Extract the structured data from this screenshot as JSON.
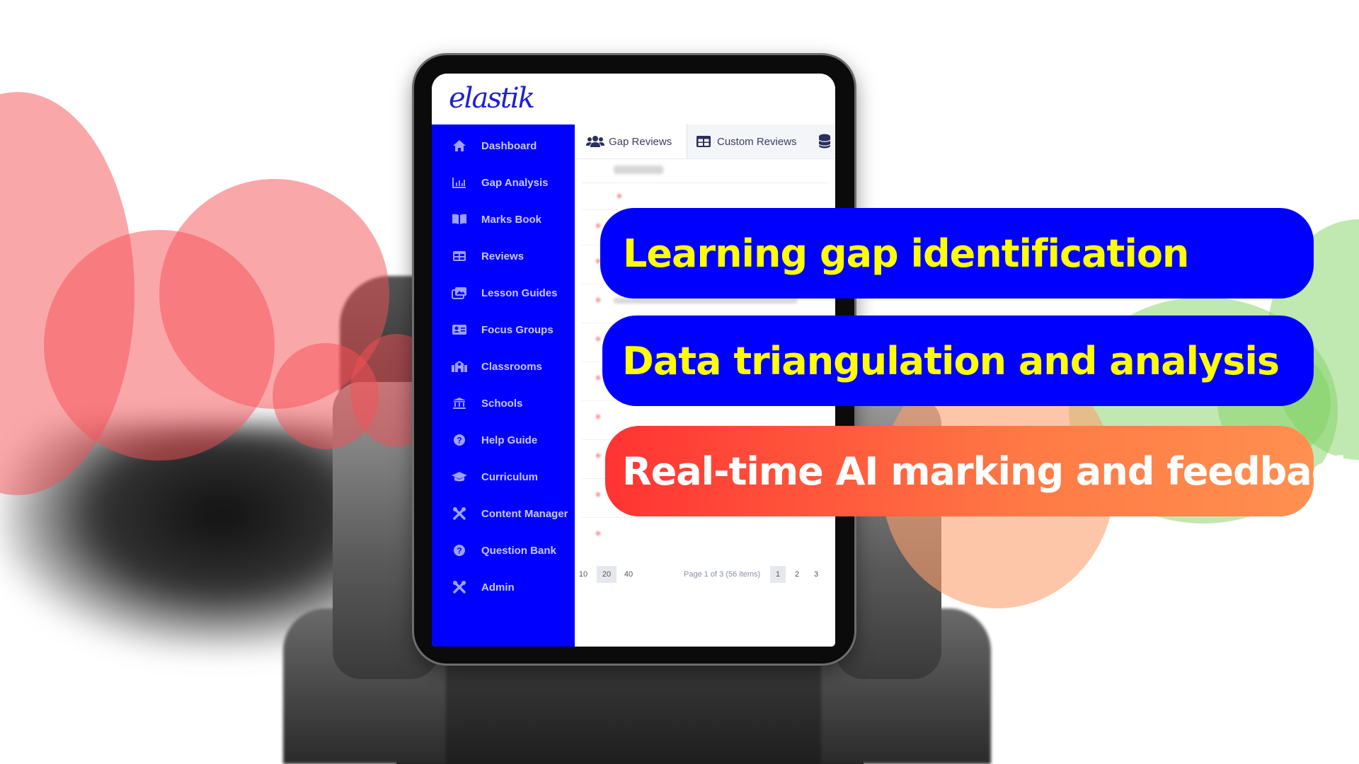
{
  "brand": {
    "logo_text": "elastik",
    "primary_color": "#0000ff",
    "highlight_text_color": "#ffff00"
  },
  "sidebar": {
    "items": [
      {
        "label": "Dashboard",
        "icon": "home-icon"
      },
      {
        "label": "Gap Analysis",
        "icon": "bar-chart-icon"
      },
      {
        "label": "Marks Book",
        "icon": "open-book-icon"
      },
      {
        "label": "Reviews",
        "icon": "table-icon"
      },
      {
        "label": "Lesson Guides",
        "icon": "images-icon"
      },
      {
        "label": "Focus Groups",
        "icon": "id-card-icon"
      },
      {
        "label": "Classrooms",
        "icon": "school-building-icon"
      },
      {
        "label": "Schools",
        "icon": "university-icon"
      },
      {
        "label": "Help Guide",
        "icon": "question-circle-icon"
      },
      {
        "label": "Curriculum",
        "icon": "graduation-cap-icon"
      },
      {
        "label": "Content Manager",
        "icon": "tools-icon"
      },
      {
        "label": "Question Bank",
        "icon": "question-circle-icon"
      },
      {
        "label": "Admin",
        "icon": "tools-icon"
      }
    ]
  },
  "tabs": [
    {
      "label": "Gap Reviews",
      "icon": "users-icon",
      "active": true
    },
    {
      "label": "Custom Reviews",
      "icon": "table-icon",
      "active": false
    },
    {
      "label": "",
      "icon": "database-icon",
      "active": false
    }
  ],
  "table": {
    "header_label": "Test name"
  },
  "pager": {
    "page_sizes": [
      "10",
      "20",
      "40"
    ],
    "selected_page_size": "20",
    "info": "Page 1 of 3 (56 items)",
    "pages": [
      "1",
      "2",
      "3"
    ],
    "current_page": "1"
  },
  "banners": [
    {
      "text": "Learning gap identification"
    },
    {
      "text": "Data triangulation and analysis"
    },
    {
      "text": "Real-time AI marking and feedback"
    }
  ]
}
